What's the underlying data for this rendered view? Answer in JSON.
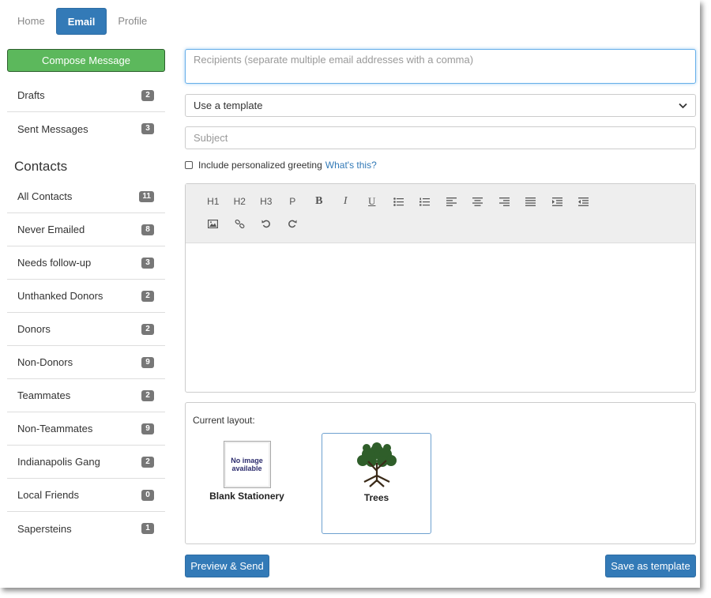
{
  "nav": {
    "tabs": [
      {
        "label": "Home"
      },
      {
        "label": "Email"
      },
      {
        "label": "Profile"
      }
    ]
  },
  "sidebar": {
    "compose_label": "Compose Message",
    "top_items": [
      {
        "label": "Drafts",
        "count": "2"
      },
      {
        "label": "Sent Messages",
        "count": "3"
      }
    ],
    "contacts_heading": "Contacts",
    "contact_items": [
      {
        "label": "All Contacts",
        "count": "11"
      },
      {
        "label": "Never Emailed",
        "count": "8"
      },
      {
        "label": "Needs follow-up",
        "count": "3"
      },
      {
        "label": "Unthanked Donors",
        "count": "2"
      },
      {
        "label": "Donors",
        "count": "2"
      },
      {
        "label": "Non-Donors",
        "count": "9"
      },
      {
        "label": "Teammates",
        "count": "2"
      },
      {
        "label": "Non-Teammates",
        "count": "9"
      },
      {
        "label": "Indianapolis Gang",
        "count": "2"
      },
      {
        "label": "Local Friends",
        "count": "0"
      },
      {
        "label": "Sapersteins",
        "count": "1"
      }
    ]
  },
  "form": {
    "recipients_placeholder": "Recipients (separate multiple email addresses with a comma)",
    "template_selected": "Use a template",
    "subject_placeholder": "Subject",
    "greeting_label": "Include personalized greeting",
    "greeting_link": "What's this?"
  },
  "toolbar": {
    "h1": "H1",
    "h2": "H2",
    "h3": "H3",
    "p": "P",
    "bold": "B",
    "italic": "I",
    "underline": "U"
  },
  "layout": {
    "label": "Current layout:",
    "blank_image_text": "No image available",
    "blank_name": "Blank Stationery",
    "trees_name": "Trees"
  },
  "actions": {
    "preview_send": "Preview & Send",
    "save_template": "Save as template"
  },
  "colors": {
    "primary": "#337ab7",
    "success": "#5cb85c",
    "badge": "#777777"
  }
}
